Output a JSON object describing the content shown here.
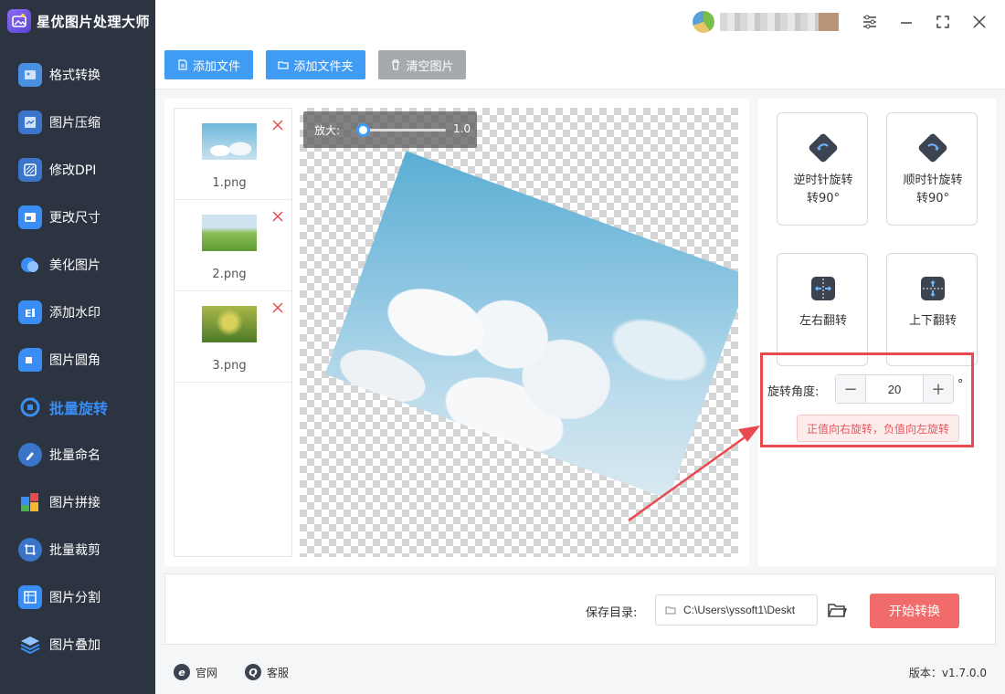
{
  "app": {
    "title": "星优图片处理大师"
  },
  "sidebar": {
    "items": [
      {
        "label": "格式转换",
        "icon": "image-convert-icon",
        "color": "#4a90e2"
      },
      {
        "label": "图片压缩",
        "icon": "image-compress-icon",
        "color": "#4a90e2"
      },
      {
        "label": "修改DPI",
        "icon": "dpi-icon",
        "color": "#4a90e2"
      },
      {
        "label": "更改尺寸",
        "icon": "resize-icon",
        "color": "#4a90e2"
      },
      {
        "label": "美化图片",
        "icon": "beautify-icon",
        "color": "#4a90e2"
      },
      {
        "label": "添加水印",
        "icon": "watermark-icon",
        "color": "#4a90e2"
      },
      {
        "label": "图片圆角",
        "icon": "round-corner-icon",
        "color": "#4a90e2"
      },
      {
        "label": "批量旋转",
        "icon": "rotate-icon",
        "color": "#3a8df5",
        "active": true
      },
      {
        "label": "批量命名",
        "icon": "rename-icon",
        "color": "#4a90e2"
      },
      {
        "label": "图片拼接",
        "icon": "stitch-icon",
        "color": "#4a90e2"
      },
      {
        "label": "批量裁剪",
        "icon": "crop-icon",
        "color": "#4a90e2"
      },
      {
        "label": "图片分割",
        "icon": "split-icon",
        "color": "#4a90e2"
      },
      {
        "label": "图片叠加",
        "icon": "layers-icon",
        "color": "#4a90e2"
      }
    ]
  },
  "toolbar": {
    "add_file": "添加文件",
    "add_folder": "添加文件夹",
    "clear": "清空图片"
  },
  "files": [
    {
      "name": "1.png",
      "thumb": "sky-clouds"
    },
    {
      "name": "2.png",
      "thumb": "green-field"
    },
    {
      "name": "3.png",
      "thumb": "flowers"
    }
  ],
  "preview": {
    "zoom_label": "放大:",
    "zoom_value": "1.0",
    "zoom_fraction": 0.05
  },
  "operations": {
    "ccw": "逆时针旋转\n转90°",
    "cw": "顺时针旋转\n转90°",
    "flip_h": "左右翻转",
    "flip_v": "上下翻转",
    "angle_label": "旋转角度:",
    "angle_value": "20",
    "degree": "°",
    "hint": "正值向右旋转，负值向左旋转",
    "minus": "−",
    "plus": "+"
  },
  "save": {
    "label": "保存目录:",
    "path": "C:\\Users\\yssoft1\\Deskt",
    "start": "开始转换"
  },
  "footer": {
    "website": "官网",
    "support": "客服",
    "version": "版本：v1.7.0.0"
  },
  "colors": {
    "accent": "#3f9bf3",
    "danger": "#f26b6b",
    "highlight": "#e84a50",
    "sidebar": "#2b3440"
  }
}
